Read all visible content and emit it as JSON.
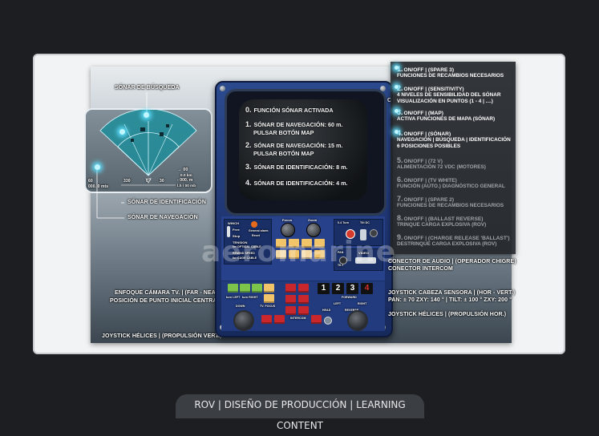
{
  "footer": {
    "title": "ROV | DISEÑO DE PRODUCCIÓN | LEARNING CONTENT"
  },
  "watermark": "aeromarine",
  "left_labels": {
    "sonar_busqueda": "SÓNAR DE BÚSQUEDA",
    "sonar_identificacion": "SÓNAR DE IDENTIFICACIÓN",
    "sonar_navegacion": "SÓNAR DE NAVEGACIÓN",
    "enfoque_camara": "ENFOQUE CÁMARA TV. | (FAR - NEAR)",
    "posicion_punto": "POSICIÓN DE PUNTO INICIAL CENTRAL",
    "joystick_helices_vert": "JOYSTICK HÉLICES | (PROPULSIÓN VERT.)"
  },
  "right_labels": {
    "conector_audio": "CONECTOR DE AUDIO | (OPERADOR CHIGRE)",
    "conector_intercom": "CONECTOR INTERCOM",
    "joystick_cabeza": "JOYSTICK CABEZA SENSORA | (HOR - VERT.)",
    "pan_tilt": "PAN: ± 70 ZXY: 140 ° | TILT: ± 100 ° ZXY: 200 °",
    "joystick_helices_hor": "JOYSTICK HÉLICES | (PROPULSIÓN HOR.)",
    "c_marker": "C"
  },
  "sonar_display": {
    "readout_1": "→ 00",
    "readout_2": "0.0 km",
    "readout_3": "- 000. m",
    "readout_4": "l.h / 00 mb",
    "scale_left": "60",
    "scale_left2": "000. 0 mts",
    "scale_a": "330",
    "scale_b": "0",
    "scale_c": "30"
  },
  "screen": {
    "lines": [
      {
        "num": "0.",
        "text": "FUNCIÓN SÓNAR ACTIVADA",
        "text2": ""
      },
      {
        "num": "1.",
        "text": "SÓNAR DE NAVEGACIÓN: 60 m.",
        "text2": "PULSAR BOTÓN MAP"
      },
      {
        "num": "2.",
        "text": "SÓNAR DE NAVEGACIÓN: 15 m.",
        "text2": "PULSAR BOTÓN MAP"
      },
      {
        "num": "3.",
        "text": "SÓNAR DE IDENTIFICACIÓN: 8 m.",
        "text2": ""
      },
      {
        "num": "4.",
        "text": "SÓNAR DE IDENTIFICACIÓN: 4 m.",
        "text2": ""
      }
    ]
  },
  "console": {
    "winch": "WINCH",
    "free": "Free",
    "stop": "Stop",
    "tension": "TENSION",
    "for_optical": "for OPTICAL CABLE",
    "remind": "REMIND SPEED",
    "for_cable": "for CAGE CABLE",
    "general_alarm": "General alarm",
    "reset": "Reset",
    "focus": "Focus",
    "zoom": "Zoom",
    "power": "0.4 Turn",
    "on_off": "Tilt DC",
    "video": "VIDEO",
    "pan": "PAN",
    "tilt": "TILT",
    "keys": [
      "1",
      "2",
      "3",
      "4"
    ],
    "forward": "FORWARD",
    "down": "DOWN",
    "tv_focus": "TV. FOCUS",
    "intercom": "INTERCOM",
    "head": "HEAD",
    "reverse": "REVERSE",
    "turn_left": "turn LEFT",
    "turn_right": "turn RIGHT",
    "left": "LEFT",
    "right": "RIGHT"
  },
  "info_panel": {
    "items": [
      {
        "num": "1.",
        "head": "ON/OFF | (SPARE 3)",
        "desc": [
          "FUNCIONES DE RECAMBIOS NECESARIOS"
        ],
        "dim": false
      },
      {
        "num": "2.",
        "head": "ON/OFF | (SENSITIVITY)",
        "desc": [
          "4 NIVELES DE SENSIBILIDAD DEL SÓNAR",
          "VISUALIZACIÓN EN PUNTOS (1 - 4 | ....)"
        ],
        "dim": false
      },
      {
        "num": "3.",
        "head": "ON/OFF | (MAP)",
        "desc": [
          "ACTIVA FUNCIONES DE MAPA (SÓNAR)"
        ],
        "dim": false
      },
      {
        "num": "4.",
        "head": "ON/OFF | (SÓNAR)",
        "desc": [
          "NAVEGACIÓN | BÚSQUEDA | IDENTIFICACIÓN",
          "6 POSICIONES POSIBLES"
        ],
        "dim": false
      },
      {
        "num": "5.",
        "head": "ON/OFF | (72 V)",
        "desc": [
          "ALIMENTACIÓN 72 VDC (MOTORES)"
        ],
        "dim": true
      },
      {
        "num": "6.",
        "head": "ON/OFF | (TV WHITE)",
        "desc": [
          "FUNCIÓN (AUTO.) DIAGNÓSTICO GENERAL"
        ],
        "dim": true
      },
      {
        "num": "7.",
        "head": "ON/OFF | (SPARE 2)",
        "desc": [
          "FUNCIONES DE RECAMBIOS NECESARIOS"
        ],
        "dim": true
      },
      {
        "num": "8.",
        "head": "ON/OFF | (BALLAST REVERSE)",
        "desc": [
          "TRINQUE CARGA EXPLOSIVA (ROV)"
        ],
        "dim": true
      },
      {
        "num": "9.",
        "head": "ON/OFF | (CHARGE RELEASE 'BALLAST')",
        "desc": [
          "DESTRINQUE CARGA EXPLOSIVA (ROV)"
        ],
        "dim": true
      }
    ]
  },
  "colors": {
    "console_blue": "#1e3470",
    "glow": "#5fe0ff",
    "button_orange": "#f2c46a",
    "button_red": "#c9272b",
    "button_green": "#7cc44a",
    "key_red": "#d6302a"
  }
}
